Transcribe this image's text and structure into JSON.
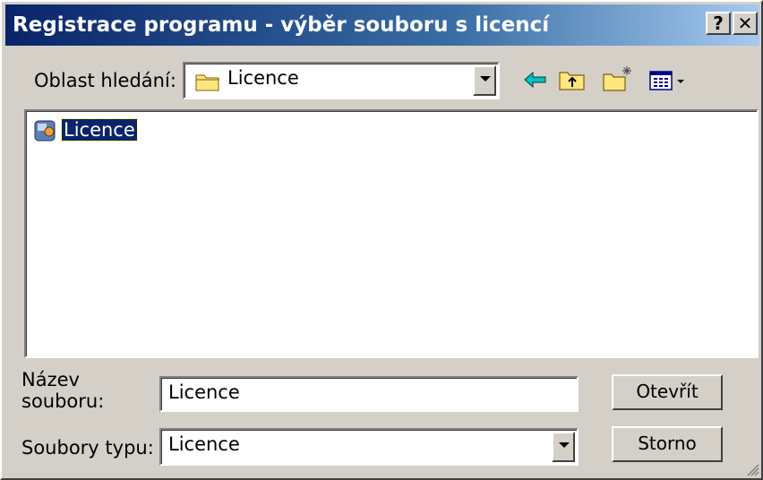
{
  "window": {
    "title": "Registrace programu - výběr souboru s licencí",
    "help_label": "?",
    "close_label": "✕"
  },
  "toolbar": {
    "look_in_label": "Oblast hledání:",
    "look_in_value": "Licence",
    "icons": [
      "folder-icon",
      "back-arrow-icon",
      "up-folder-icon",
      "new-folder-icon",
      "view-menu-icon"
    ]
  },
  "file_list": {
    "items": [
      {
        "name": "Licence",
        "icon": "license-file-icon",
        "selected": true
      }
    ]
  },
  "filename": {
    "label_line1": "Název",
    "label_line2": "souboru:",
    "value": "Licence"
  },
  "filetype": {
    "label": "Soubory typu:",
    "value": "Licence"
  },
  "buttons": {
    "open": "Otevřít",
    "cancel": "Storno"
  },
  "colors": {
    "titlebar_start": "#0a246a",
    "titlebar_end": "#a6caf0",
    "face": "#d4d0c8",
    "selection": "#0a246a"
  }
}
